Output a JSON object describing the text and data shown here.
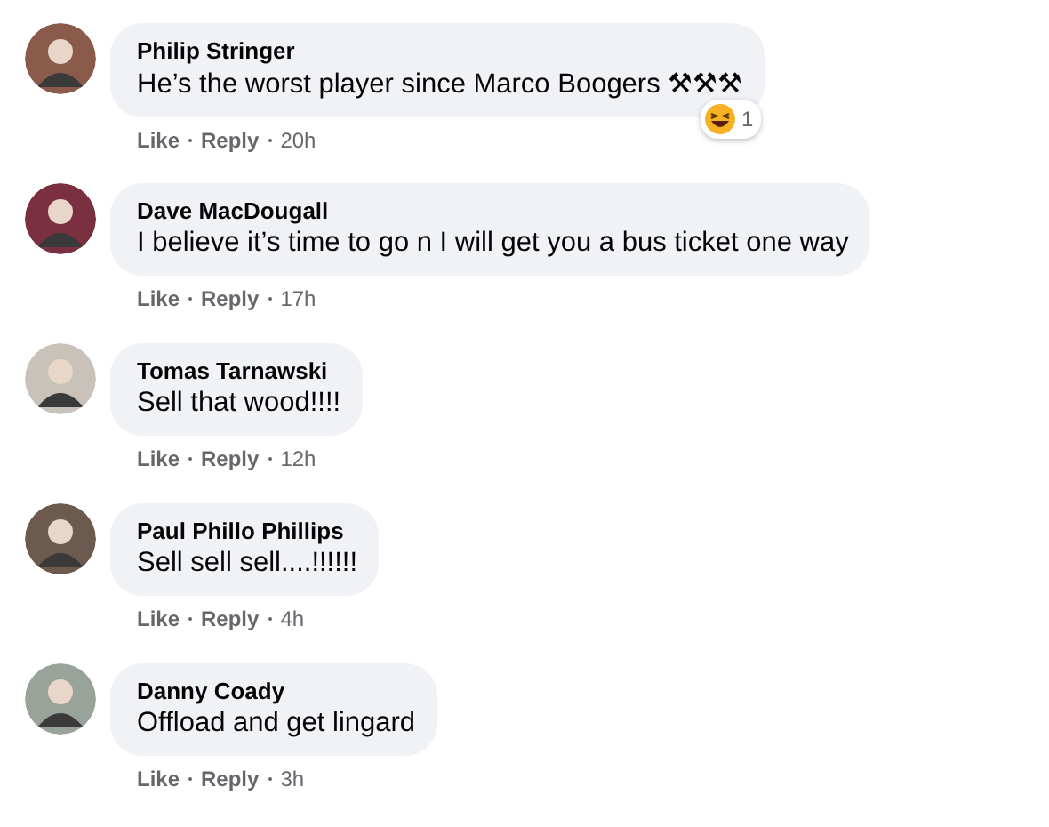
{
  "comments": [
    {
      "author": "Philip Stringer",
      "text": "He’s the worst player since Marco Boogers ⚒⚒⚒",
      "reaction": {
        "count": "1"
      },
      "like": "Like",
      "reply": "Reply",
      "time": "20h"
    },
    {
      "author": "Dave MacDougall",
      "text": "I believe it’s time to go n I will get you a bus ticket one way",
      "like": "Like",
      "reply": "Reply",
      "time": "17h"
    },
    {
      "author": "Tomas Tarnawski",
      "text": "Sell that wood!!!!",
      "like": "Like",
      "reply": "Reply",
      "time": "12h"
    },
    {
      "author": "Paul Phillo Phillips",
      "text": "Sell sell sell....!!!!!!",
      "like": "Like",
      "reply": "Reply",
      "time": "4h"
    },
    {
      "author": "Danny Coady",
      "text": "Offload and get lingard",
      "like": "Like",
      "reply": "Reply",
      "time": "3h"
    }
  ]
}
